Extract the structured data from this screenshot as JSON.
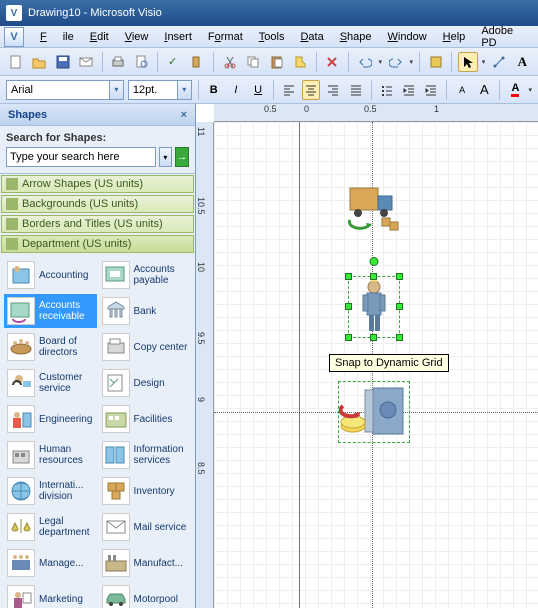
{
  "title_doc": "Drawing10",
  "title_app": "Microsoft Visio",
  "menu": {
    "file": "File",
    "edit": "Edit",
    "view": "View",
    "insert": "Insert",
    "format": "Format",
    "tools": "Tools",
    "data": "Data",
    "shape": "Shape",
    "window": "Window",
    "help": "Help",
    "adobe": "Adobe PD"
  },
  "font_name": "Arial",
  "font_size": "12pt.",
  "shapes_panel": {
    "title": "Shapes",
    "search_label": "Search for Shapes:",
    "search_value": "Type your search here",
    "go": "→",
    "stencils": [
      "Arrow Shapes (US units)",
      "Backgrounds (US units)",
      "Borders and Titles (US units)",
      "Department (US units)"
    ],
    "shapes": [
      {
        "label": "Accounting"
      },
      {
        "label": "Accounts payable"
      },
      {
        "label": "Accounts receivable"
      },
      {
        "label": "Bank"
      },
      {
        "label": "Board of directors"
      },
      {
        "label": "Copy center"
      },
      {
        "label": "Customer service"
      },
      {
        "label": "Design"
      },
      {
        "label": "Engineering"
      },
      {
        "label": "Facilities"
      },
      {
        "label": "Human resources"
      },
      {
        "label": "Information services"
      },
      {
        "label": "Internati... division"
      },
      {
        "label": "Inventory"
      },
      {
        "label": "Legal department"
      },
      {
        "label": "Mail service"
      },
      {
        "label": "Manage..."
      },
      {
        "label": "Manufact..."
      },
      {
        "label": "Marketing"
      },
      {
        "label": "Motorpool"
      }
    ]
  },
  "ruler_h": [
    "0.5",
    "0",
    "0.5",
    "1"
  ],
  "ruler_v": [
    "11",
    "10.5",
    "10",
    "9.5",
    "9",
    "8.5"
  ],
  "tooltip": "Snap to Dynamic Grid"
}
